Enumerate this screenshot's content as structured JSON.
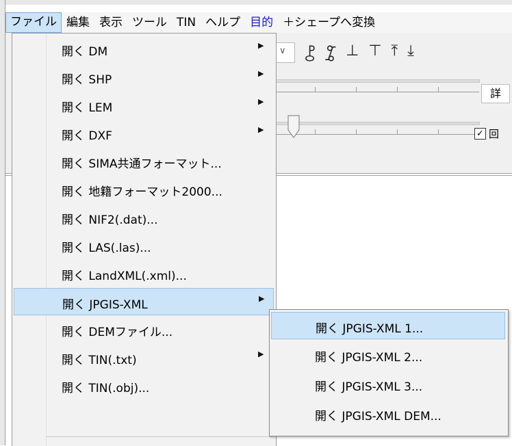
{
  "menubar": {
    "items": [
      {
        "label": "ファイル",
        "active": true
      },
      {
        "label": "編集"
      },
      {
        "label": "表示"
      },
      {
        "label": "ツール"
      },
      {
        "label": "TIN"
      },
      {
        "label": "ヘルプ"
      },
      {
        "label": "目的",
        "color": "#1a1acc"
      },
      {
        "label": "＋シェープへ変換"
      }
    ]
  },
  "toolbar": {
    "detail_label": "詳",
    "checkbox_mark": "✓",
    "checkbox_partial_label": "回"
  },
  "file_menu": {
    "items": [
      {
        "label": "開く DM",
        "submenu": true
      },
      {
        "label": "開く SHP",
        "submenu": true
      },
      {
        "label": "開く LEM",
        "submenu": true
      },
      {
        "label": "開く DXF",
        "submenu": true
      },
      {
        "label": "開く SIMA共通フォーマット..."
      },
      {
        "label": "開く 地籍フォーマット2000..."
      },
      {
        "label": "開く NIF2(.dat)..."
      },
      {
        "label": "開く LAS(.las)..."
      },
      {
        "label": "開く LandXML(.xml)..."
      },
      {
        "label": "開く JPGIS-XML",
        "submenu": true,
        "highlighted": true
      },
      {
        "label": "開く DEMファイル..."
      },
      {
        "label": "開く TIN(.txt)",
        "submenu": true
      },
      {
        "label": "開く TIN(.obj)..."
      }
    ]
  },
  "jpgis_submenu": {
    "items": [
      {
        "label": "開く JPGIS-XML 1...",
        "highlighted": true
      },
      {
        "label": "開く JPGIS-XML 2..."
      },
      {
        "label": "開く JPGIS-XML 3..."
      },
      {
        "label": "開く JPGIS-XML DEM..."
      }
    ]
  },
  "colors": {
    "highlight": "#cce4f7",
    "highlight_border": "#99c1e8",
    "menu_bg": "#f2f2f2",
    "accent_text": "#1a1acc"
  }
}
